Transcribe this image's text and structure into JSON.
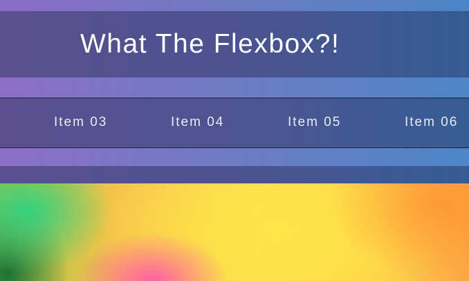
{
  "header": {
    "title": "What The Flexbox?!"
  },
  "nav": {
    "items": [
      {
        "label": "Item 03"
      },
      {
        "label": "Item 04"
      },
      {
        "label": "Item 05"
      },
      {
        "label": "Item 06"
      }
    ]
  },
  "colors": {
    "gradient_start": "#8a6fc7",
    "gradient_end": "#4a86c6",
    "bar_start": "#5b4f8e",
    "bar_end": "#355c92",
    "text": "#ffffff"
  }
}
